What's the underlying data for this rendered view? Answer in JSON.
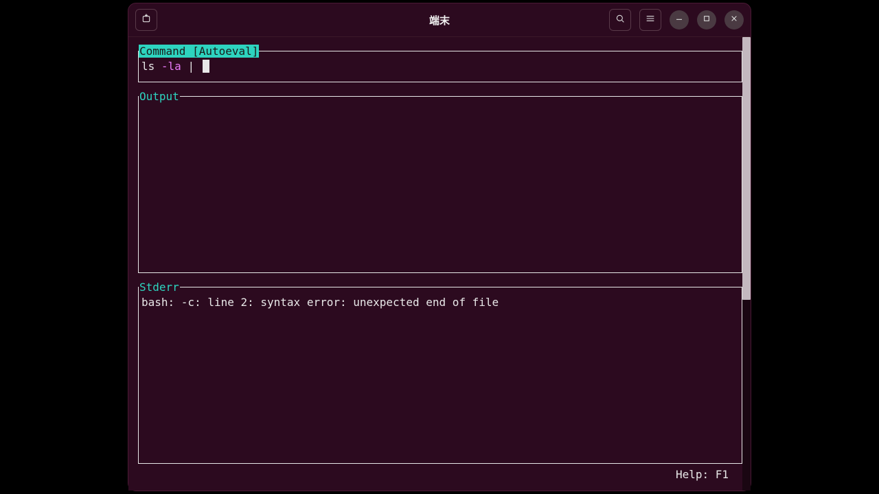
{
  "window": {
    "title": "端末"
  },
  "panels": {
    "command": {
      "label": "Command [Autoeval]",
      "cmd_name": "ls",
      "cmd_flag": "-la",
      "cmd_tail": " | "
    },
    "output": {
      "label": "Output",
      "content": ""
    },
    "stderr": {
      "label": "Stderr",
      "content": "bash: -c: line 2: syntax error: unexpected end of file"
    }
  },
  "footer": {
    "help": "Help: F1"
  }
}
